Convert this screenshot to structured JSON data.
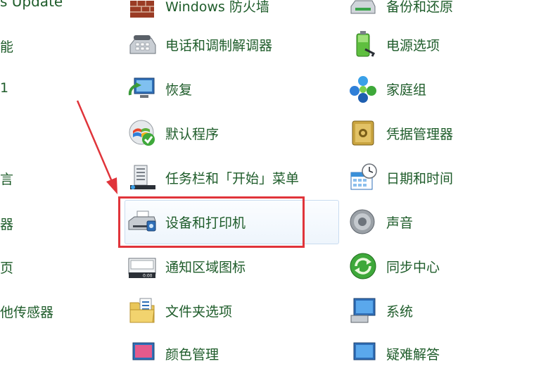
{
  "left_column": [
    {
      "text": "s Update",
      "id": "left-windows-update"
    },
    {
      "text": "能",
      "id": "left-2"
    },
    {
      "text": "1",
      "id": "left-3"
    },
    {
      "text": "言",
      "id": "left-4"
    },
    {
      "text": "器",
      "id": "left-5"
    },
    {
      "text": "页",
      "id": "left-6"
    },
    {
      "text": "他传感器",
      "id": "left-7"
    }
  ],
  "middle_column": [
    {
      "label": "Windows 防火墙",
      "icon": "firewall-icon"
    },
    {
      "label": "电话和调制解调器",
      "icon": "phone-modem-icon"
    },
    {
      "label": "恢复",
      "icon": "recovery-icon"
    },
    {
      "label": "默认程序",
      "icon": "default-programs-icon"
    },
    {
      "label": "任务栏和「开始」菜单",
      "icon": "taskbar-start-menu-icon"
    },
    {
      "label": "设备和打印机",
      "icon": "devices-printers-icon"
    },
    {
      "label": "通知区域图标",
      "icon": "notification-area-icon"
    },
    {
      "label": "文件夹选项",
      "icon": "folder-options-icon"
    },
    {
      "label": "颜色管理",
      "icon": "color-management-icon"
    }
  ],
  "right_column": [
    {
      "label": "备份和还原",
      "icon": "backup-restore-icon"
    },
    {
      "label": "电源选项",
      "icon": "power-options-icon"
    },
    {
      "label": "家庭组",
      "icon": "homegroup-icon"
    },
    {
      "label": "凭据管理器",
      "icon": "credential-manager-icon"
    },
    {
      "label": "日期和时间",
      "icon": "date-time-icon"
    },
    {
      "label": "声音",
      "icon": "sound-icon"
    },
    {
      "label": "同步中心",
      "icon": "sync-center-icon"
    },
    {
      "label": "系统",
      "icon": "system-icon"
    },
    {
      "label": "疑难解答",
      "icon": "troubleshooting-icon"
    }
  ],
  "colors": {
    "link": "#1e5c2a",
    "highlight_border": "#c9dcf0",
    "annotation_red": "#e0343a"
  }
}
